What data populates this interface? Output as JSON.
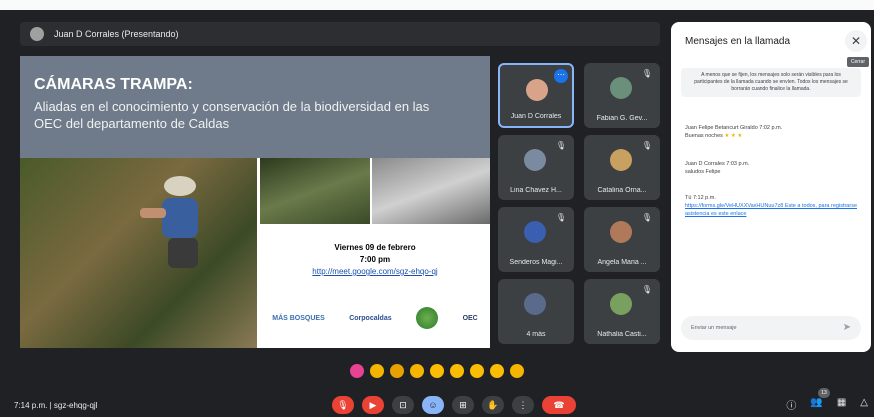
{
  "presenter": {
    "label": "Juan D Corrales (Presentando)"
  },
  "slide": {
    "title": "CÁMARAS TRAMPA:",
    "subtitle": "Aliadas en el conocimiento y conservación de la biodiversidad en las OEC del departamento de Caldas",
    "date": "Viernes 09 de febrero",
    "time": "7:00 pm",
    "link": "http://meet.google.com/sgz-ehqo-qj",
    "logos": [
      "MÁS BOSQUES",
      "Corpocaldas",
      "OEC"
    ]
  },
  "participants": [
    {
      "name": "Juan D Corrales",
      "active": true,
      "avatar_color": "#d9a38a"
    },
    {
      "name": "Fabian G. Gev...",
      "active": false,
      "avatar_color": "#6a8f7a"
    },
    {
      "name": "Lina Chavez H...",
      "active": false,
      "avatar_color": "#7a8aa0"
    },
    {
      "name": "Catalina Orna...",
      "active": false,
      "avatar_color": "#c8a060"
    },
    {
      "name": "Senderos Magi...",
      "active": false,
      "avatar_color": "#3a5fb0"
    },
    {
      "name": "Angela Maria ...",
      "active": false,
      "avatar_color": "#b07a5a"
    },
    {
      "name": "4 más",
      "active": false,
      "avatar_color": "#5a6a8a"
    },
    {
      "name": "Nathalia Casti...",
      "active": false,
      "avatar_color": "#7aa060"
    }
  ],
  "chat": {
    "title": "Mensajes en la llamada",
    "close_tooltip": "Cerrar",
    "notice": "A menos que se fijen, los mensajes solo serán visibles para los participantes de la llamada cuando se envíen. Todos los mensajes se borrarán cuando finalice la llamada.",
    "messages": [
      {
        "sender": "Juan Felipe Betancurt Giraldo 7:02 p.m.",
        "text": "Buenas noches",
        "stars": "★ ★ ★"
      },
      {
        "sender": "Juan D Corrales 7:03 p.m.",
        "text": "saludos Felipe"
      },
      {
        "sender": "Tú 7:12 p.m.",
        "text": "https://forms.gle/VeHUXXVaxHUNuu7z8 Este a todos, para registrarse asistencia es este enlace"
      }
    ],
    "input_placeholder": "Enviar un mensaje"
  },
  "footer": {
    "time_code": "7:14 p.m. | sgz-ehqg-qjl",
    "participant_count": "13"
  },
  "icons": {
    "reactions": [
      "heart",
      "thumbs-up",
      "party",
      "clap",
      "laugh",
      "surprised",
      "sad",
      "thinking",
      "thumbs-down"
    ]
  }
}
